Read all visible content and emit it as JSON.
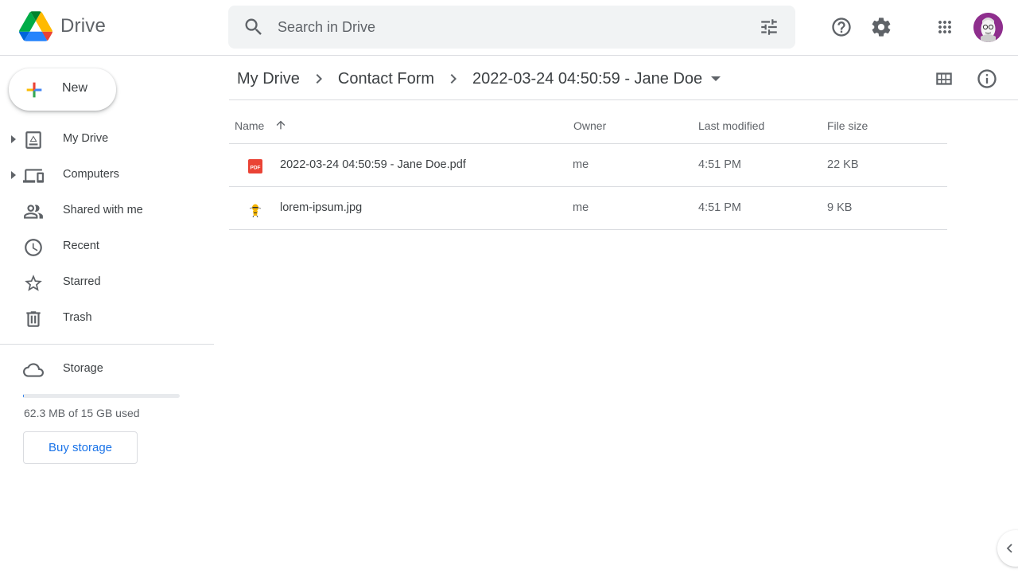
{
  "app": {
    "name": "Drive"
  },
  "search": {
    "placeholder": "Search in Drive"
  },
  "header": {
    "help_icon": "help-circle-icon",
    "settings_icon": "gear-icon",
    "apps_icon": "apps-grid-icon"
  },
  "sidebar": {
    "new_label": "New",
    "items": [
      {
        "label": "My Drive",
        "icon": "my-drive-icon",
        "expandable": true
      },
      {
        "label": "Computers",
        "icon": "computers-icon",
        "expandable": true
      },
      {
        "label": "Shared with me",
        "icon": "shared-people-icon",
        "expandable": false
      },
      {
        "label": "Recent",
        "icon": "clock-icon",
        "expandable": false
      },
      {
        "label": "Starred",
        "icon": "star-icon",
        "expandable": false
      },
      {
        "label": "Trash",
        "icon": "trash-icon",
        "expandable": false
      }
    ],
    "storage": {
      "label": "Storage",
      "usage_text": "62.3 MB of 15 GB used",
      "used_fraction": 0.004,
      "buy_label": "Buy storage"
    }
  },
  "breadcrumb": {
    "items": [
      "My Drive",
      "Contact Form",
      "2022-03-24 04:50:59 - Jane Doe"
    ]
  },
  "table": {
    "columns": {
      "name": "Name",
      "owner": "Owner",
      "modified": "Last modified",
      "size": "File size"
    },
    "sort": "name-ascending",
    "rows": [
      {
        "name": "2022-03-24 04:50:59 - Jane Doe.pdf",
        "type": "pdf",
        "owner": "me",
        "modified": "4:51 PM",
        "size": "22 KB"
      },
      {
        "name": "lorem-ipsum.jpg",
        "type": "image",
        "owner": "me",
        "modified": "4:51 PM",
        "size": "9 KB"
      }
    ]
  },
  "colors": {
    "accent": "#1a73e8",
    "pdf_red": "#ea4335",
    "text": "#3c4043",
    "muted": "#5f6368"
  }
}
